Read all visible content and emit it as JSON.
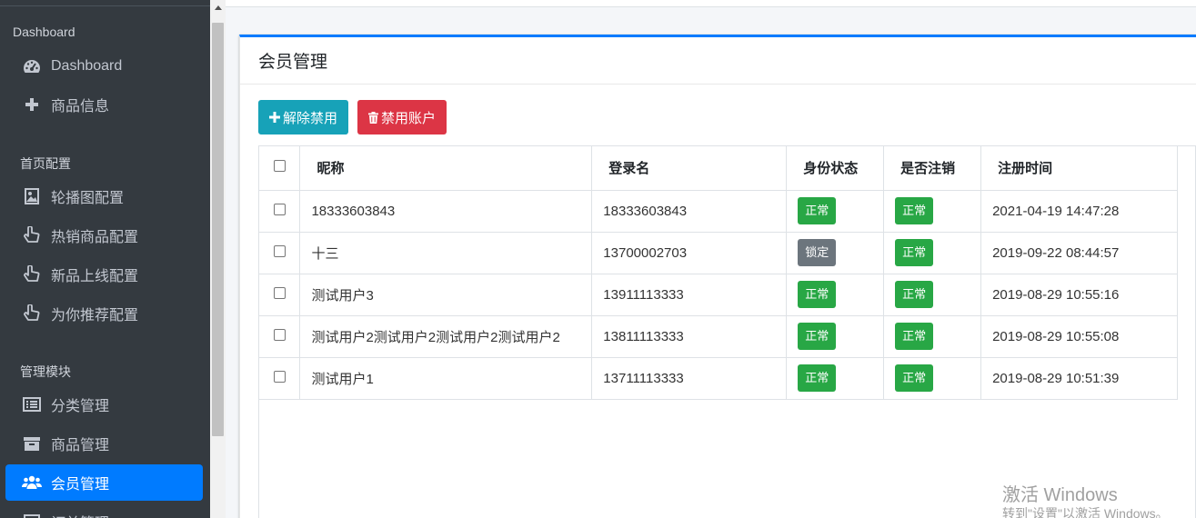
{
  "sidebar": {
    "sections": [
      {
        "title": "Dashboard",
        "items": [
          {
            "label": "Dashboard",
            "icon": "tachometer-icon"
          },
          {
            "label": "商品信息",
            "icon": "plus-icon"
          }
        ]
      },
      {
        "title": "首页配置",
        "items": [
          {
            "label": "轮播图配置",
            "icon": "image-icon"
          },
          {
            "label": "热销商品配置",
            "icon": "hand-pointer-icon"
          },
          {
            "label": "新品上线配置",
            "icon": "hand-pointer-icon"
          },
          {
            "label": "为你推荐配置",
            "icon": "hand-pointer-icon"
          }
        ]
      },
      {
        "title": "管理模块",
        "items": [
          {
            "label": "分类管理",
            "icon": "list-icon"
          },
          {
            "label": "商品管理",
            "icon": "archive-icon"
          },
          {
            "label": "会员管理",
            "icon": "users-icon",
            "active": true
          },
          {
            "label": "订单管理",
            "icon": "order-icon"
          }
        ]
      }
    ]
  },
  "card": {
    "title": "会员管理"
  },
  "toolbar": {
    "unban_label": "解除禁用",
    "ban_label": "禁用账户"
  },
  "table": {
    "headers": [
      "昵称",
      "登录名",
      "身份状态",
      "是否注销",
      "注册时间"
    ],
    "rows": [
      {
        "nickname": "18333603843",
        "login": "18333603843",
        "status": "正常",
        "status_color": "#28a745",
        "deleted": "正常",
        "time": "2021-04-19 14:47:28"
      },
      {
        "nickname": "十三",
        "login": "13700002703",
        "status": "锁定",
        "status_color": "#6c757d",
        "deleted": "正常",
        "time": "2019-09-22 08:44:57"
      },
      {
        "nickname": "测试用户3",
        "login": "13911113333",
        "status": "正常",
        "status_color": "#28a745",
        "deleted": "正常",
        "time": "2019-08-29 10:55:16"
      },
      {
        "nickname": "测试用户2测试用户2测试用户2测试用户2",
        "login": "13811113333",
        "status": "正常",
        "status_color": "#28a745",
        "deleted": "正常",
        "time": "2019-08-29 10:55:08"
      },
      {
        "nickname": "测试用户1",
        "login": "13711113333",
        "status": "正常",
        "status_color": "#28a745",
        "deleted": "正常",
        "time": "2019-08-29 10:51:39"
      }
    ]
  },
  "watermark": {
    "line1": "激活 Windows",
    "line2": "转到\"设置\"以激活 Windows。"
  },
  "colors": {
    "sidebar_bg": "#343a40",
    "accent": "#007bff",
    "info": "#17a2b8",
    "danger": "#dc3545",
    "success": "#28a745",
    "secondary": "#6c757d"
  }
}
